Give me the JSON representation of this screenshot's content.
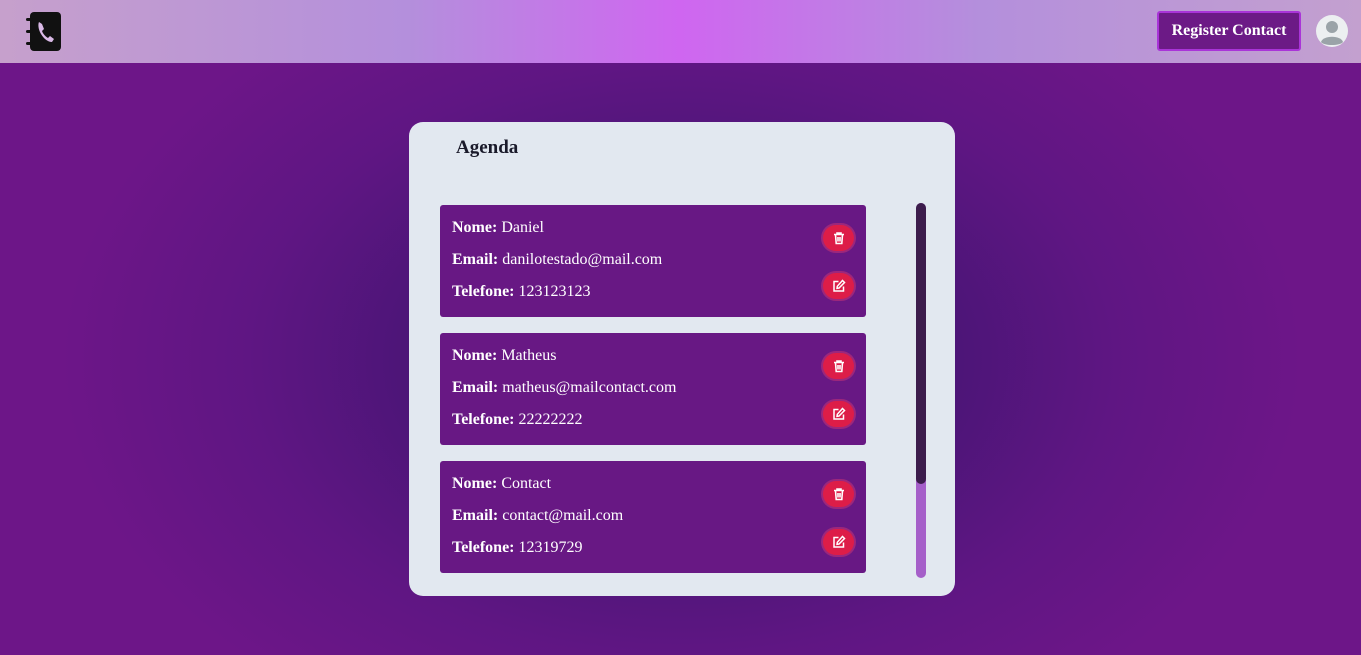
{
  "header": {
    "register_label": "Register Contact",
    "logo_icon": "phone-book-icon",
    "avatar_icon": "user-avatar-icon"
  },
  "agenda": {
    "title": "Agenda",
    "field_labels": {
      "name": "Nome:",
      "email": "Email:",
      "phone": "Telefone:"
    },
    "contacts": [
      {
        "name": "Daniel",
        "email": "danilotestado@mail.com",
        "phone": "123123123"
      },
      {
        "name": "Matheus",
        "email": "matheus@mailcontact.com",
        "phone": "22222222"
      },
      {
        "name": "Contact",
        "email": "contact@mail.com",
        "phone": "12319729"
      }
    ],
    "delete_icon": "trash-icon",
    "edit_icon": "edit-icon"
  },
  "colors": {
    "background": "#5f1683",
    "header_accent": "#cf66f0",
    "card": "#681884",
    "panel": "#e2e8f0",
    "action_button": "#dd1d48",
    "scrollbar_track": "#a55fc9",
    "scrollbar_thumb": "#3c1c4c"
  }
}
